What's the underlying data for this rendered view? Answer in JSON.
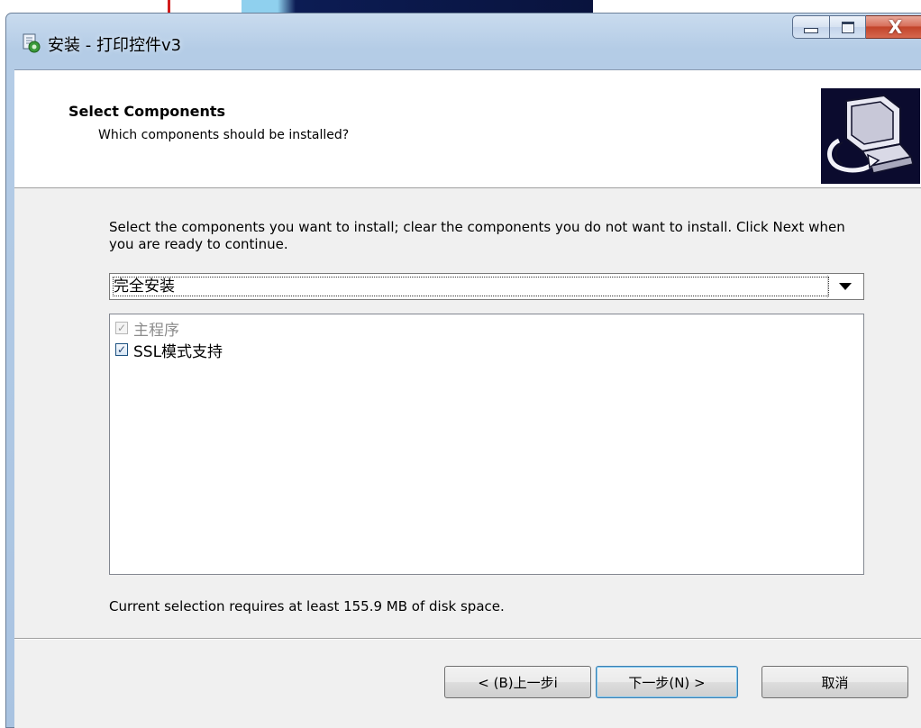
{
  "window": {
    "title": "安装 - 打印控件v3",
    "close_glyph": "X"
  },
  "header": {
    "title": "Select Components",
    "subtitle": "Which components should be installed?"
  },
  "main": {
    "description": "Select the components you want to install; clear the components you do not want to install. Click Next when you are ready to continue.",
    "setup_type": "完全安装",
    "components": [
      {
        "label": "主程序",
        "checked": true,
        "enabled": false
      },
      {
        "label": "SSL模式支持",
        "checked": true,
        "enabled": true
      }
    ],
    "check_mark": "✓",
    "disk_space": "Current selection requires at least 155.9 MB of disk space."
  },
  "buttons": {
    "back": "< (B)上一步i",
    "next": "下一步(N) >",
    "cancel": "取消"
  },
  "colors": {
    "accent": "#3c7fb1",
    "close_button": "#c2442a",
    "title_gradient": "#b4cce6"
  }
}
